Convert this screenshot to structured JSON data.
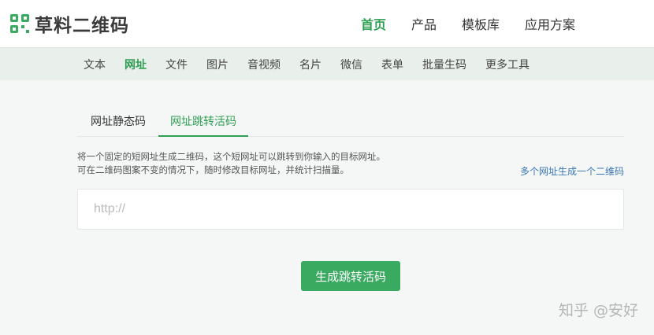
{
  "brand": {
    "name": "草料二维码",
    "icon": "qr-logo-icon",
    "color": "#3aaa60"
  },
  "main_nav": [
    {
      "label": "首页",
      "active": true
    },
    {
      "label": "产品",
      "active": false
    },
    {
      "label": "模板库",
      "active": false
    },
    {
      "label": "应用方案",
      "active": false
    }
  ],
  "sub_nav": [
    {
      "label": "文本",
      "active": false
    },
    {
      "label": "网址",
      "active": true
    },
    {
      "label": "文件",
      "active": false
    },
    {
      "label": "图片",
      "active": false
    },
    {
      "label": "音视频",
      "active": false
    },
    {
      "label": "名片",
      "active": false
    },
    {
      "label": "微信",
      "active": false
    },
    {
      "label": "表单",
      "active": false
    },
    {
      "label": "批量生码",
      "active": false
    },
    {
      "label": "更多工具",
      "active": false
    }
  ],
  "tabs": {
    "static": "网址静态码",
    "dynamic": "网址跳转活码",
    "active": "dynamic"
  },
  "description": {
    "line1": "将一个固定的短网址生成二维码，这个短网址可以跳转到你输入的目标网址。",
    "line2": "可在二维码图案不变的情况下，随时修改目标网址，并统计扫描量。"
  },
  "multi_link": "多个网址生成一个二维码",
  "url_input": {
    "placeholder": "http://",
    "value": ""
  },
  "generate_button": "生成跳转活码",
  "watermark": "知乎 @安好",
  "colors": {
    "accent": "#2e9e52",
    "link": "#3a77b6",
    "subnav_bg": "#e9efeb"
  }
}
